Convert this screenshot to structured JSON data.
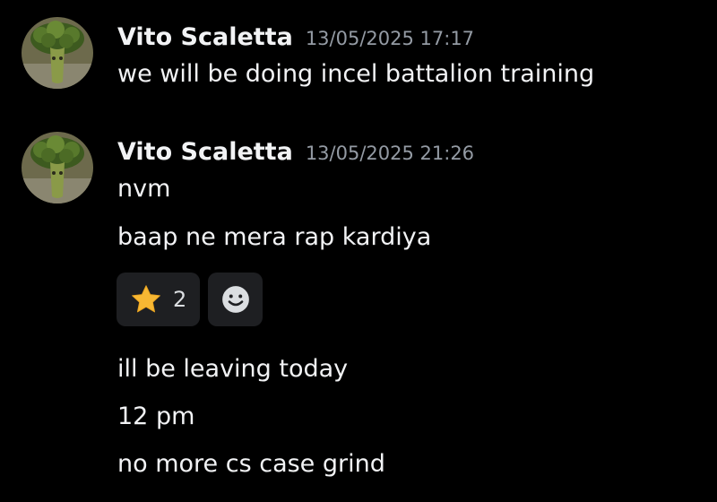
{
  "messages": [
    {
      "author": "Vito Scaletta",
      "timestamp": "13/05/2025 17:17",
      "lines": [
        "we will be doing incel battalion training"
      ]
    },
    {
      "author": "Vito Scaletta",
      "timestamp": "13/05/2025 21:26",
      "lines": [
        "nvm",
        "baap ne mera rap kardiya"
      ],
      "reactions": [
        {
          "emoji": "star-icon",
          "count": "2",
          "color": "#f7b733"
        }
      ],
      "add_reaction_icon": "smiley-add-icon",
      "lines_after_reactions": [
        "ill be leaving today",
        "12 pm",
        "no more cs case grind"
      ]
    }
  ],
  "colors": {
    "background": "#000000",
    "text": "#f2f3f5",
    "timestamp": "#949ba4",
    "reaction_bg": "#1e1f22"
  }
}
